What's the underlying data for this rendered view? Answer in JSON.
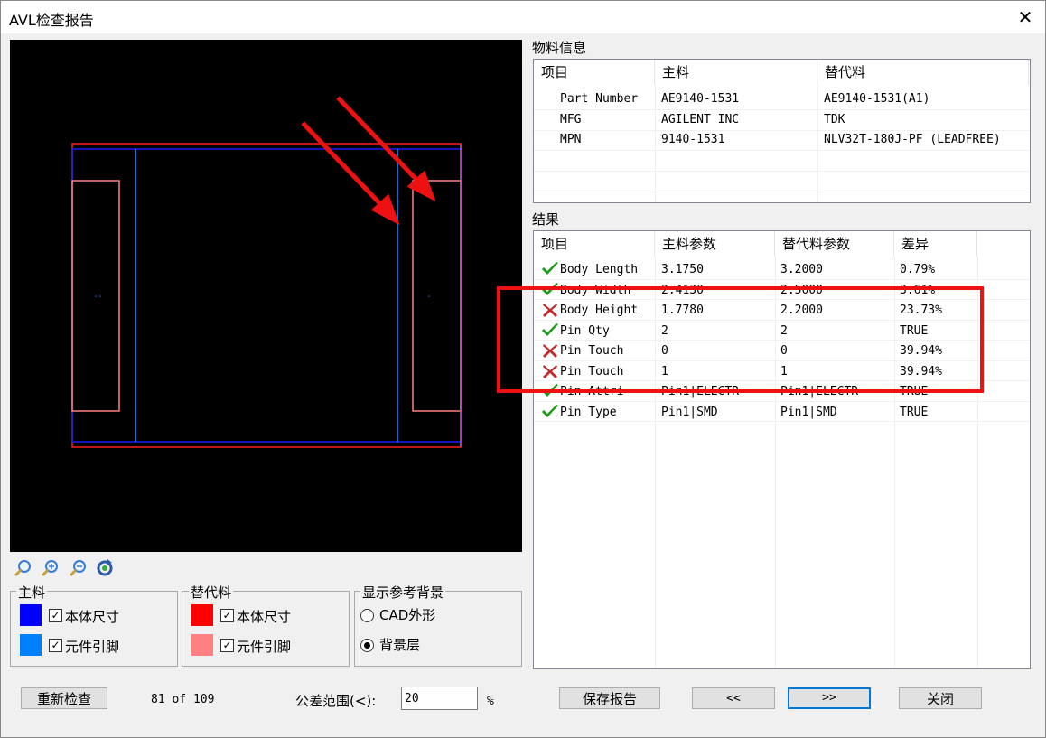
{
  "window": {
    "title": "AVL检查报告",
    "close_glyph": "✕"
  },
  "groups": {
    "main": {
      "title": "主料",
      "body_label": "本体尺寸",
      "pin_label": "元件引脚",
      "body_color": "#0000ff",
      "pin_color": "#0080ff",
      "checked_glyph": "✓"
    },
    "alt": {
      "title": "替代料",
      "body_label": "本体尺寸",
      "pin_label": "元件引脚",
      "body_color": "#ff0000",
      "pin_color": "#ff8080",
      "checked_glyph": "✓"
    },
    "bg": {
      "title": "显示参考背景",
      "option1": "CAD外形",
      "option2": "背景层",
      "selected": "背景层"
    }
  },
  "material_info": {
    "title": "物料信息",
    "headers": [
      "项目",
      "主料",
      "替代料"
    ],
    "rows": [
      [
        "Part Number",
        "AE9140-1531",
        "AE9140-1531(A1)"
      ],
      [
        "MFG",
        "AGILENT INC",
        "TDK"
      ],
      [
        "MPN",
        "9140-1531",
        "NLV32T-180J-PF (LEADFREE)"
      ]
    ]
  },
  "results": {
    "title": "结果",
    "headers": [
      "项目",
      "主料参数",
      "替代料参数",
      "差异"
    ],
    "rows": [
      {
        "status": "pass",
        "item": "Body Length",
        "main": "3.1750",
        "alt": "3.2000",
        "diff": "0.79%"
      },
      {
        "status": "pass",
        "item": "Body Width",
        "main": "2.4130",
        "alt": "2.5000",
        "diff": "3.61%"
      },
      {
        "status": "fail",
        "item": "Body Height",
        "main": "1.7780",
        "alt": "2.2000",
        "diff": "23.73%"
      },
      {
        "status": "pass",
        "item": "Pin Qty",
        "main": "2",
        "alt": "2",
        "diff": "TRUE"
      },
      {
        "status": "fail",
        "item": "Pin Touch",
        "main": "0",
        "alt": "0",
        "diff": "39.94%"
      },
      {
        "status": "fail",
        "item": "Pin Touch",
        "main": "1",
        "alt": "1",
        "diff": "39.94%"
      },
      {
        "status": "pass",
        "item": "Pin Attri",
        "main": "Pin1|ELECTR",
        "alt": "Pin1|ELECTR",
        "diff": "TRUE"
      },
      {
        "status": "pass",
        "item": "Pin Type",
        "main": "Pin1|SMD",
        "alt": "Pin1|SMD",
        "diff": "TRUE"
      }
    ]
  },
  "bottom": {
    "recheck": "重新检查",
    "counter": "81 of 109",
    "tolerance_label": "公差范围(<):",
    "tolerance_value": "20",
    "tolerance_unit": "%",
    "save_report": "保存报告",
    "prev": "<<",
    "next": ">>",
    "close": "关闭"
  },
  "colors": {
    "annotation_red": "#ee1111",
    "pass_green": "#1a9c1a",
    "fail_red": "#c0282a"
  }
}
